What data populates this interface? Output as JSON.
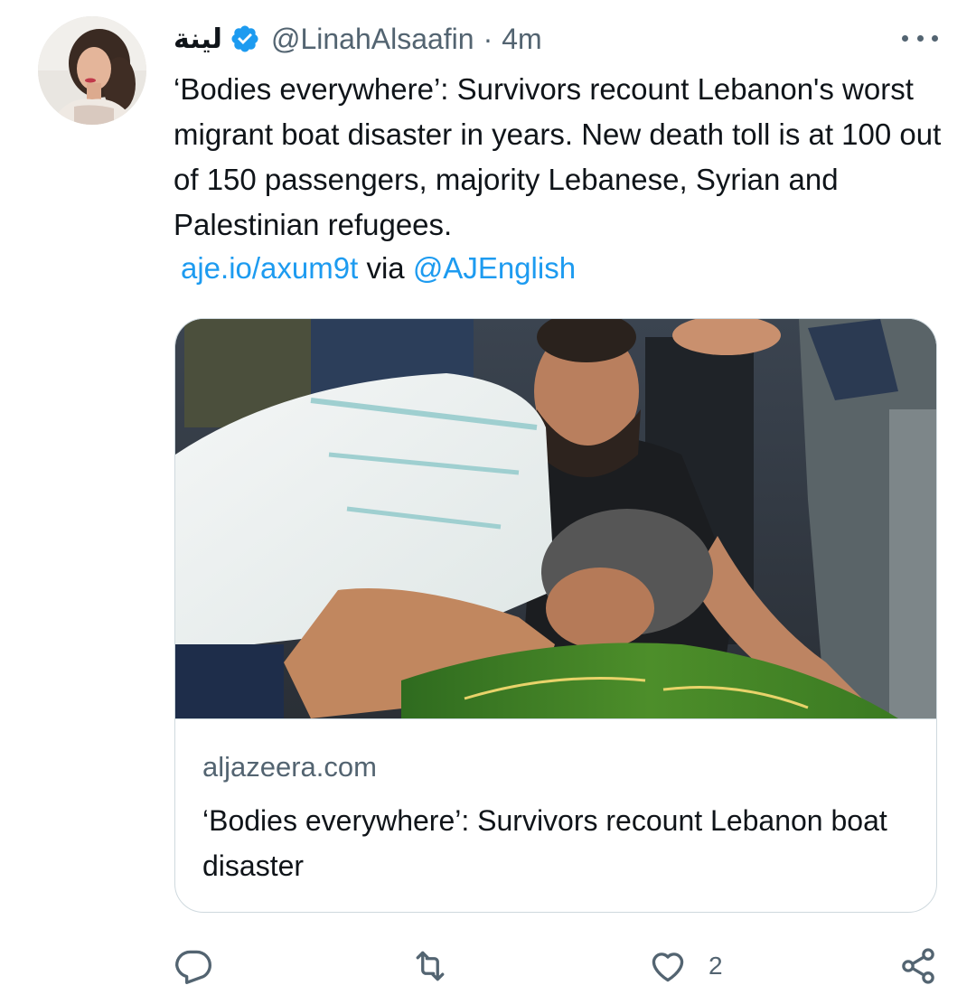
{
  "tweet": {
    "display_name": "لينة",
    "handle": "@LinahAlsaafin",
    "separator": "·",
    "time": "4m",
    "text": "‘Bodies everywhere’: Survivors recount Lebanon's worst migrant boat disaster in years. New death toll is at 100 out of 150 passengers, majority Lebanese, Syrian and Palestinian refugees.",
    "link_url": "aje.io/axum9t",
    "via": "via",
    "via_handle": "@AJEnglish"
  },
  "card": {
    "domain": "aljazeera.com",
    "title": "‘Bodies everywhere’: Survivors recount Lebanon boat disaster"
  },
  "actions": {
    "reply_icon": "reply-icon",
    "retweet_icon": "retweet-icon",
    "like_icon": "heart-icon",
    "like_count": "2",
    "share_icon": "share-icon"
  },
  "colors": {
    "accent": "#1d9bf0",
    "secondary_text": "#536471",
    "border": "#cfd9de"
  }
}
